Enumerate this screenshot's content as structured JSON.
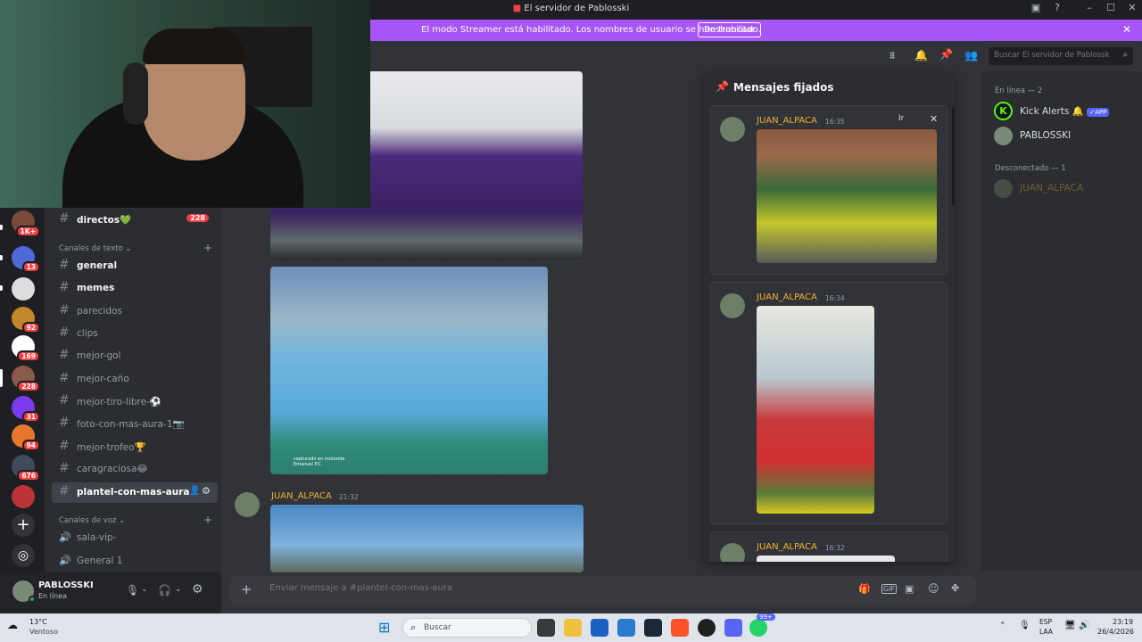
{
  "window": {
    "title": "El servidor de Pablosski"
  },
  "banner": {
    "message": "El modo Streamer está habilitado. Los nombres de usuario se han truncado.",
    "button": "Deshabilitar"
  },
  "server_badges": [
    "1K+",
    "13",
    "92",
    "169",
    "228",
    "31",
    "94",
    "676"
  ],
  "channels": {
    "directos": {
      "name": "directos",
      "emoji": "💚",
      "badge": "228"
    },
    "text_category": "Canales de texto",
    "text": [
      {
        "name": "general"
      },
      {
        "name": "memes"
      },
      {
        "name": "parecidos"
      },
      {
        "name": "clips"
      },
      {
        "name": "mejor-gol"
      },
      {
        "name": "mejor-caño"
      },
      {
        "name": "mejor-tiro-libre-⚽"
      },
      {
        "name": "foto-con-mas-aura-1📷"
      },
      {
        "name": "mejor-trofeo🏆"
      },
      {
        "name": "caragraciosa😂"
      },
      {
        "name": "plantel-con-mas-aura"
      }
    ],
    "voice_category": "Canales de voz",
    "voice": [
      {
        "name": "sala-vip-"
      },
      {
        "name": "General 1"
      }
    ]
  },
  "user": {
    "name": "PABLOSSKI",
    "status": "En línea"
  },
  "chat": {
    "message": {
      "author": "JUAN_ALPACA",
      "time": "21:32"
    },
    "photo_caption": "capturado en motorola\nEmanuel P.C.",
    "composer_placeholder": "Enviar mensaje a #plantel-con-mas-aura"
  },
  "toolbar": {
    "search_placeholder": "Buscar El servidor de Pablosski"
  },
  "pinned": {
    "title": "Mensajes fijados",
    "jump": "Ir",
    "messages": [
      {
        "author": "JUAN_ALPACA",
        "time": "16:35"
      },
      {
        "author": "JUAN_ALPACA",
        "time": "16:34"
      },
      {
        "author": "JUAN_ALPACA",
        "time": "16:32"
      }
    ]
  },
  "members": {
    "online_header": "En línea — 2",
    "online": [
      {
        "name": "Kick Alerts",
        "tag": "APP"
      },
      {
        "name": "PABLOSSKI"
      }
    ],
    "offline_header": "Desconectado — 1",
    "offline": [
      {
        "name": "JUAN_ALPACA"
      }
    ]
  },
  "taskbar": {
    "weather_temp": "13°C",
    "weather_desc": "Ventoso",
    "search": "Buscar",
    "lang": "ESP",
    "layout": "LAA",
    "time": "23:19",
    "date": "26/4/2026",
    "notif_badge": "99+"
  },
  "colors": {
    "accent": "#5865f2",
    "banner": "#a855f7",
    "username": "#f0b232",
    "online": "#23a55a"
  }
}
